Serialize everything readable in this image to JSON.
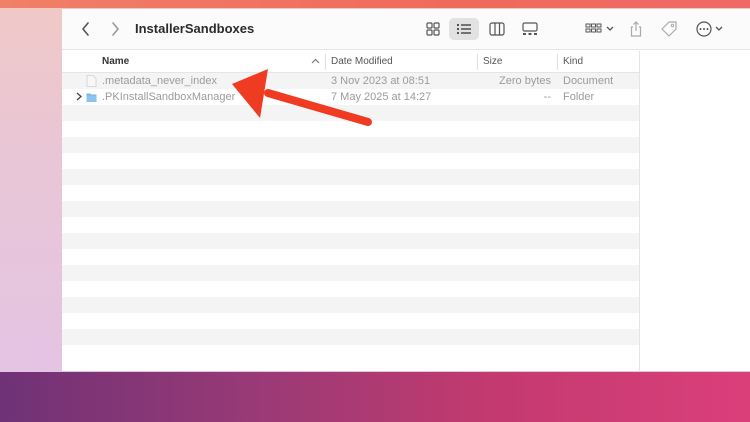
{
  "window": {
    "title": "InstallerSandboxes"
  },
  "toolbar": {
    "back_icon": "chevron-left-icon",
    "forward_icon": "chevron-right-icon",
    "view_buttons": [
      "icon-view-icon",
      "list-view-icon",
      "column-view-icon",
      "gallery-view-icon"
    ],
    "active_view": "list-view-icon",
    "group_icon": "group-by-icon",
    "share_icon": "share-icon",
    "tag_icon": "tag-icon",
    "more_icon": "more-actions-icon"
  },
  "columns": {
    "name": "Name",
    "date": "Date Modified",
    "size": "Size",
    "kind": "Kind"
  },
  "rows": [
    {
      "name": ".metadata_never_index",
      "date": "3 Nov 2023 at 08:51",
      "size": "Zero bytes",
      "kind": "Document",
      "icon": "document-icon"
    },
    {
      "name": ".PKInstallSandboxManager",
      "date": "7 May 2025 at 14:27",
      "size": "--",
      "kind": "Folder",
      "icon": "folder-icon"
    }
  ],
  "annotation": {
    "icon": "red-arrow-icon",
    "color": "#ef3b22"
  },
  "colors": {
    "accent": "#ef3b22",
    "folder": "#74b6ea"
  }
}
